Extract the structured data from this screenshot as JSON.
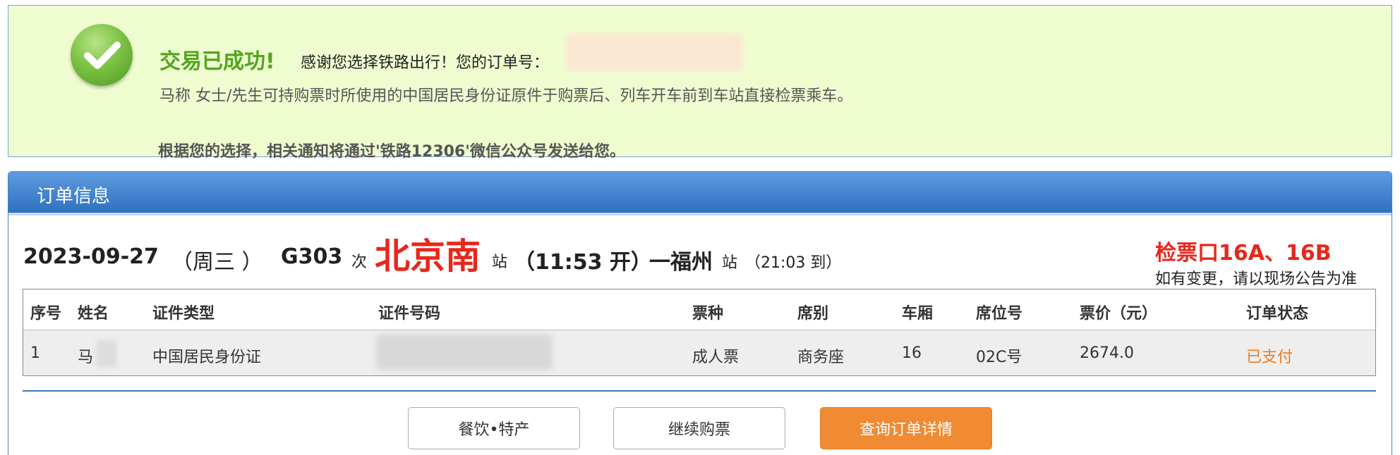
{
  "success": {
    "title": "交易已成功!",
    "thanks": "感谢您选择铁路出行！您的订单号：",
    "line2": "马称 女士/先生可持购票时所使用的中国居民身份证原件于购票后、列车开车前到车站直接检票乘车。",
    "line3": "根据您的选择，相关通知将通过'铁路12306'微信公众号发送给您。",
    "icon": "checkmark-icon"
  },
  "panel": {
    "title": "订单信息"
  },
  "train": {
    "date": "2023-09-27",
    "weekday": "（周三 ）",
    "number": "G303",
    "ci": "次",
    "from": "北京南",
    "zhan1": "站",
    "depart": "（11:53 开）",
    "to": "一福州",
    "zhan2": "站",
    "arrive": "（21:03 到）"
  },
  "gate": {
    "label": "检票口16A、16B",
    "note": "如有变更，请以现场公告为准"
  },
  "table": {
    "headers": [
      "序号",
      "姓名",
      "证件类型",
      "证件号码",
      "票种",
      "席别",
      "车厢",
      "席位号",
      "票价（元）",
      "订单状态"
    ],
    "rows": [
      {
        "index": "1",
        "name": "马",
        "id_type": "中国居民身份证",
        "id_number": "",
        "ticket_type": "成人票",
        "seat_class": "商务座",
        "coach": "16",
        "seat_no": "02C号",
        "price": "2674.0",
        "status": "已支付"
      }
    ]
  },
  "buttons": {
    "food": "餐饮•特产",
    "continue": "继续购票",
    "detail": "查询订单详情"
  },
  "colors": {
    "success_bg": "#eefcd0",
    "success_title": "#54a51f",
    "header_blue": "#2f71bf",
    "red": "#e8271c",
    "orange": "#f08a33"
  }
}
